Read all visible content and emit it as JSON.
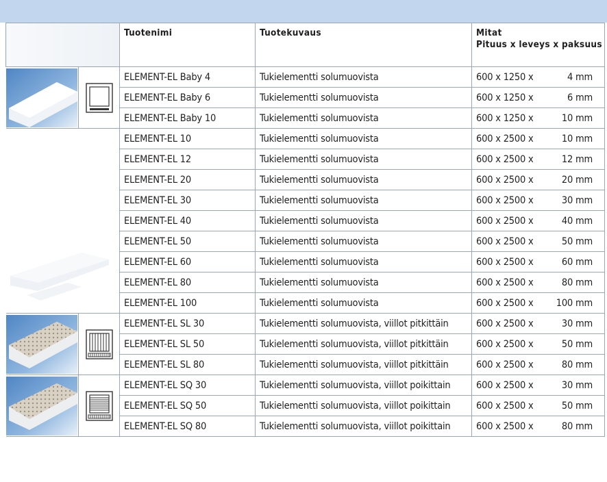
{
  "headers": {
    "name": "Tuotenimi",
    "description": "Tuotekuvaus",
    "dims_title": "Mitat",
    "dims_sub": "Pituus x leveys x paksuus"
  },
  "rows": [
    {
      "name": "ELEMENT-EL Baby 4",
      "desc": "Tukielementti solumuovista",
      "dim_a": "600 x 1250 x",
      "dim_b": "4 mm"
    },
    {
      "name": "ELEMENT-EL Baby 6",
      "desc": "Tukielementti solumuovista",
      "dim_a": "600 x 1250 x",
      "dim_b": "6 mm"
    },
    {
      "name": "ELEMENT-EL Baby 10",
      "desc": "Tukielementti solumuovista",
      "dim_a": "600 x 1250 x",
      "dim_b": "10 mm"
    },
    {
      "name": "ELEMENT-EL 10",
      "desc": "Tukielementti solumuovista",
      "dim_a": "600 x 2500 x",
      "dim_b": "10 mm"
    },
    {
      "name": "ELEMENT-EL 12",
      "desc": "Tukielementti solumuovista",
      "dim_a": "600 x 2500 x",
      "dim_b": "12 mm"
    },
    {
      "name": "ELEMENT-EL 20",
      "desc": "Tukielementti solumuovista",
      "dim_a": "600 x 2500 x",
      "dim_b": "20 mm"
    },
    {
      "name": "ELEMENT-EL 30",
      "desc": "Tukielementti solumuovista",
      "dim_a": "600 x 2500 x",
      "dim_b": "30 mm"
    },
    {
      "name": "ELEMENT-EL 40",
      "desc": "Tukielementti solumuovista",
      "dim_a": "600 x 2500 x",
      "dim_b": "40 mm"
    },
    {
      "name": "ELEMENT-EL 50",
      "desc": "Tukielementti solumuovista",
      "dim_a": "600 x 2500 x",
      "dim_b": "50 mm"
    },
    {
      "name": "ELEMENT-EL 60",
      "desc": "Tukielementti solumuovista",
      "dim_a": "600 x 2500 x",
      "dim_b": "60 mm"
    },
    {
      "name": "ELEMENT-EL 80",
      "desc": "Tukielementti solumuovista",
      "dim_a": "600 x 2500 x",
      "dim_b": "80 mm"
    },
    {
      "name": "ELEMENT-EL 100",
      "desc": "Tukielementti solumuovista",
      "dim_a": "600 x 2500 x",
      "dim_b": "100 mm"
    },
    {
      "name": "ELEMENT-EL SL 30",
      "desc": "Tukielementti solumuovista, viillot pitkittäin",
      "dim_a": "600 x 2500 x",
      "dim_b": "30 mm"
    },
    {
      "name": "ELEMENT-EL SL 50",
      "desc": "Tukielementti solumuovista, viillot pitkittäin",
      "dim_a": "600 x 2500 x",
      "dim_b": "50 mm"
    },
    {
      "name": "ELEMENT-EL SL 80",
      "desc": "Tukielementti solumuovista, viillot pitkittäin",
      "dim_a": "600 x 2500 x",
      "dim_b": "80 mm"
    },
    {
      "name": "ELEMENT-EL SQ 30",
      "desc": "Tukielementti solumuovista, viillot poikittain",
      "dim_a": "600 x 2500 x",
      "dim_b": "30 mm"
    },
    {
      "name": "ELEMENT-EL SQ 50",
      "desc": "Tukielementti solumuovista, viillot poikittain",
      "dim_a": "600 x 2500 x",
      "dim_b": "50 mm"
    },
    {
      "name": "ELEMENT-EL SQ 80",
      "desc": "Tukielementti solumuovista, viillot poikittain",
      "dim_a": "600 x 2500 x",
      "dim_b": "80 mm"
    }
  ],
  "groups": {
    "baby": {
      "thumbnail": "foam-board-thumbnail",
      "icon": "plain-board-icon"
    },
    "standard": {
      "thumbnail": "foam-board-faded-thumbnail"
    },
    "sl": {
      "thumbnail": "slit-board-thumbnail",
      "icon": "longitudinal-slits-icon"
    },
    "sq": {
      "thumbnail": "slit-board-thumbnail",
      "icon": "transverse-slits-icon"
    }
  },
  "colors": {
    "header_band": "#c2d6ee",
    "grid_lines": "#9aa6b4",
    "text": "#1f1f1f"
  }
}
